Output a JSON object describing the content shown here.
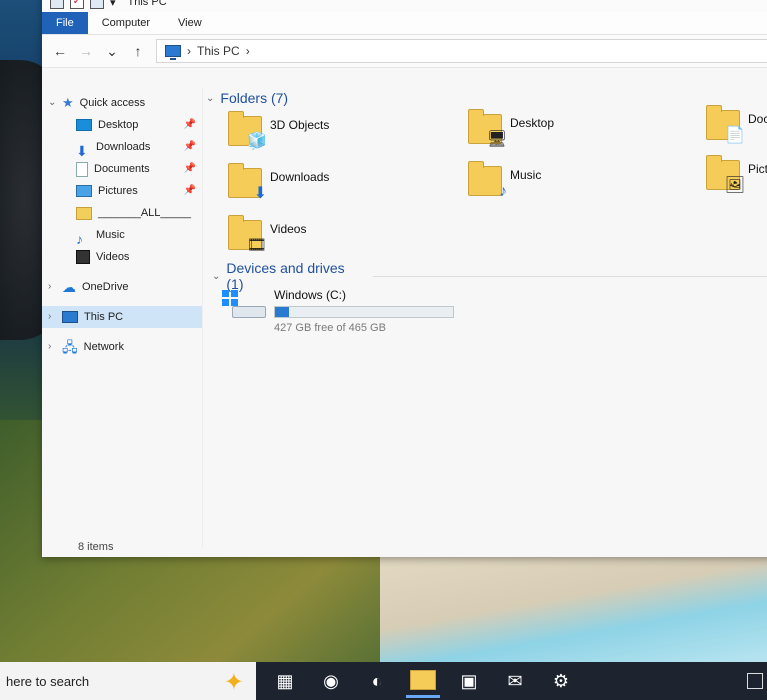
{
  "window": {
    "title": "This PC",
    "ribbon_tabs": [
      "File",
      "Computer",
      "View"
    ],
    "breadcrumb": [
      "This PC"
    ]
  },
  "sidebar": {
    "quick_access": "Quick access",
    "items": [
      {
        "label": "Desktop",
        "icon": "desktop-icon",
        "pinned": true
      },
      {
        "label": "Downloads",
        "icon": "downloads-icon",
        "pinned": true
      },
      {
        "label": "Documents",
        "icon": "documents-icon",
        "pinned": true
      },
      {
        "label": "Pictures",
        "icon": "pictures-icon",
        "pinned": true
      },
      {
        "label": "_______ALL_____",
        "icon": "folder-icon",
        "pinned": false
      },
      {
        "label": "Music",
        "icon": "music-icon",
        "pinned": false
      },
      {
        "label": "Videos",
        "icon": "videos-icon",
        "pinned": false
      }
    ],
    "onedrive": "OneDrive",
    "this_pc": "This PC",
    "network": "Network"
  },
  "content": {
    "folders_header": "Folders (7)",
    "folders": [
      {
        "label": "3D Objects",
        "icon": "3d-objects-icon"
      },
      {
        "label": "Desktop",
        "icon": "desktop-icon"
      },
      {
        "label": "Docu",
        "icon": "documents-icon"
      },
      {
        "label": "Downloads",
        "icon": "downloads-icon"
      },
      {
        "label": "Music",
        "icon": "music-icon"
      },
      {
        "label": "Pictu",
        "icon": "pictures-icon"
      },
      {
        "label": "Videos",
        "icon": "videos-icon"
      }
    ],
    "devices_header": "Devices and drives (1)",
    "drive": {
      "name": "Windows (C:)",
      "free_text": "427 GB free of 465 GB",
      "used_fraction": 0.08
    }
  },
  "status": {
    "items": "8 items"
  },
  "taskbar": {
    "search_text": "here to search"
  },
  "colors": {
    "accent": "#1f62b8",
    "selection": "#cfe5f7"
  }
}
